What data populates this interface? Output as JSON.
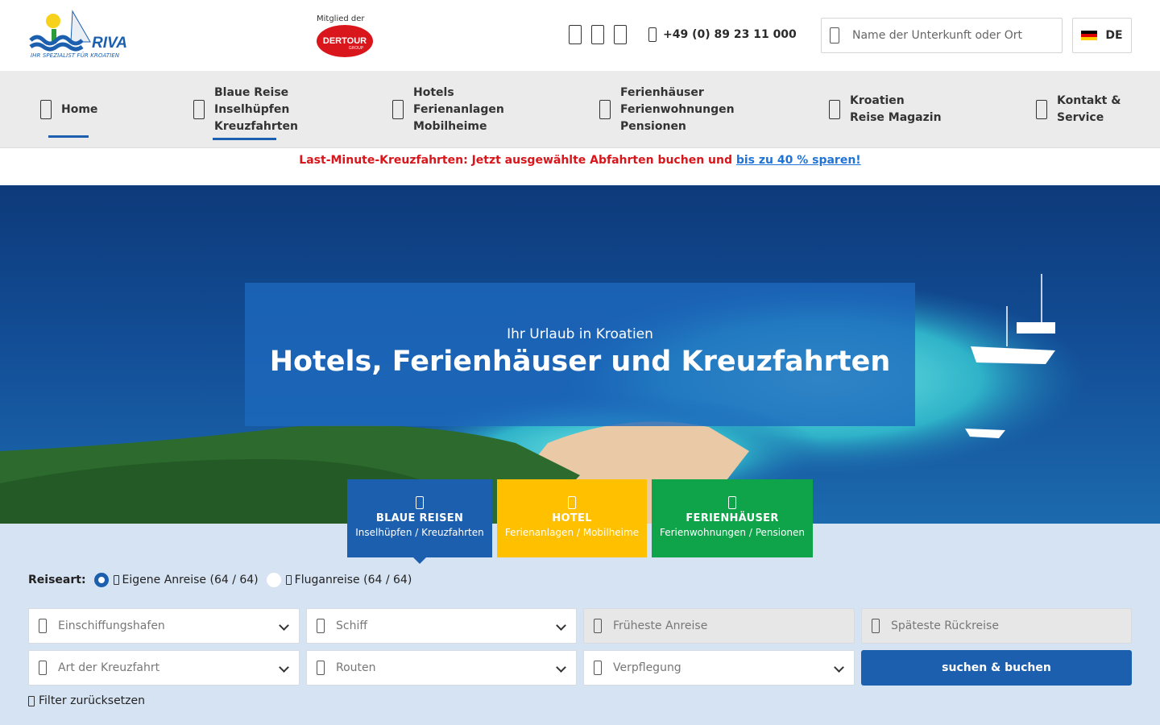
{
  "header": {
    "logo_text": "RIVA",
    "logo_tagline": "IHR SPEZIALIST FÜR KROATIEN",
    "member_label": "Mitglied der",
    "member_logo_text": "DERTOUR",
    "member_logo_sub": "GROUP",
    "phone": "+49 (0) 89 23 11 000",
    "search_placeholder": "Name der Unterkunft oder Ort",
    "language": "DE"
  },
  "nav": {
    "items": [
      {
        "label": "Home"
      },
      {
        "label": "Blaue Reise\nInselhüpfen\nKreuzfahrten"
      },
      {
        "label": "Hotels\nFerienanlagen\nMobilheime"
      },
      {
        "label": "Ferienhäuser\nFerienwohnungen\nPensionen"
      },
      {
        "label": "Kroatien\nReise Magazin"
      },
      {
        "label": "Kontakt &\nService"
      }
    ]
  },
  "promo": {
    "text": "Last-Minute-Kreuzfahrten: Jetzt ausgewählte Abfahrten buchen und ",
    "link": "bis zu 40 % sparen!"
  },
  "hero": {
    "subtitle": "Ihr Urlaub in Kroatien",
    "title": "Hotels, Ferienhäuser und Kreuzfahrten"
  },
  "tabs": [
    {
      "title": "BLAUE REISEN",
      "subtitle": "Inselhüpfen / Kreuzfahrten",
      "color": "#1b5fae"
    },
    {
      "title": "HOTEL",
      "subtitle": "Ferienanlagen / Mobilheime",
      "color": "#ffc000"
    },
    {
      "title": "FERIENHÄUSER",
      "subtitle": "Ferienwohnungen / Pensionen",
      "color": "#0fa34a"
    }
  ],
  "search_form": {
    "reiseart_label": "Reiseart:",
    "options": [
      {
        "label": "Eigene Anreise (64 / 64)",
        "selected": true
      },
      {
        "label": "Fluganreise (64 / 64)",
        "selected": false
      }
    ],
    "fields": {
      "einschiffungshafen": "Einschiffungshafen",
      "schiff": "Schiff",
      "frueheste_anreise": "Früheste Anreise",
      "spaeteste_rueckreise": "Späteste Rückreise",
      "art_der_kreuzfahrt": "Art der Kreuzfahrt",
      "routen": "Routen",
      "verpflegung": "Verpflegung"
    },
    "submit_label": "suchen & buchen",
    "reset_label": "Filter zurücksetzen"
  }
}
